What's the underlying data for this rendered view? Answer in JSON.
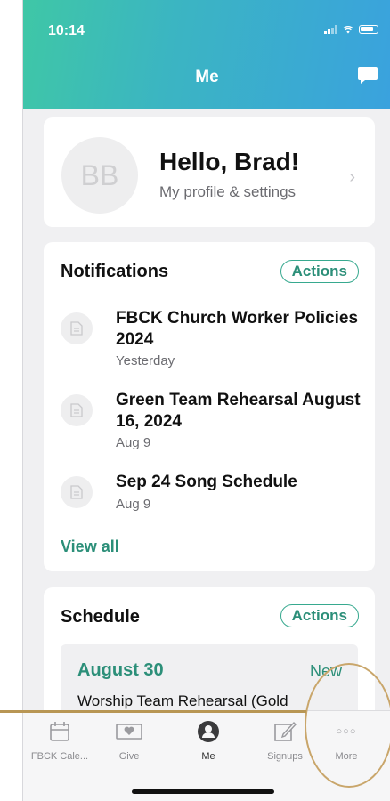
{
  "status_bar": {
    "time": "10:14"
  },
  "header": {
    "title": "Me"
  },
  "profile": {
    "initials": "BB",
    "greeting": "Hello, Brad!",
    "subtitle": "My profile & settings",
    "chevron": "›"
  },
  "notifications": {
    "title": "Notifications",
    "actions_label": "Actions",
    "items": [
      {
        "title": "FBCK Church Worker Policies 2024",
        "date": "Yesterday"
      },
      {
        "title": "Green Team Rehearsal August 16, 2024",
        "date": "Aug 9"
      },
      {
        "title": "Sep 24 Song Schedule",
        "date": "Aug 9"
      }
    ],
    "view_all_label": "View all"
  },
  "schedule": {
    "title": "Schedule",
    "actions_label": "Actions",
    "items": [
      {
        "date": "August 30",
        "badge": "New",
        "description": "Worship Team Rehearsal (Gold"
      }
    ]
  },
  "tab_bar": {
    "tabs": [
      {
        "label": "FBCK Cale...",
        "icon": "calendar-icon"
      },
      {
        "label": "Give",
        "icon": "give-icon"
      },
      {
        "label": "Me",
        "icon": "person-icon",
        "active": true
      },
      {
        "label": "Signups",
        "icon": "edit-icon"
      },
      {
        "label": "More",
        "icon": "more-dots-icon"
      }
    ],
    "more_glyph": "○○○"
  },
  "colors": {
    "accent": "#2c8f79",
    "header_gradient_start": "#3fc7a6",
    "header_gradient_end": "#3aa2de",
    "annotation": "#c9a66b"
  }
}
